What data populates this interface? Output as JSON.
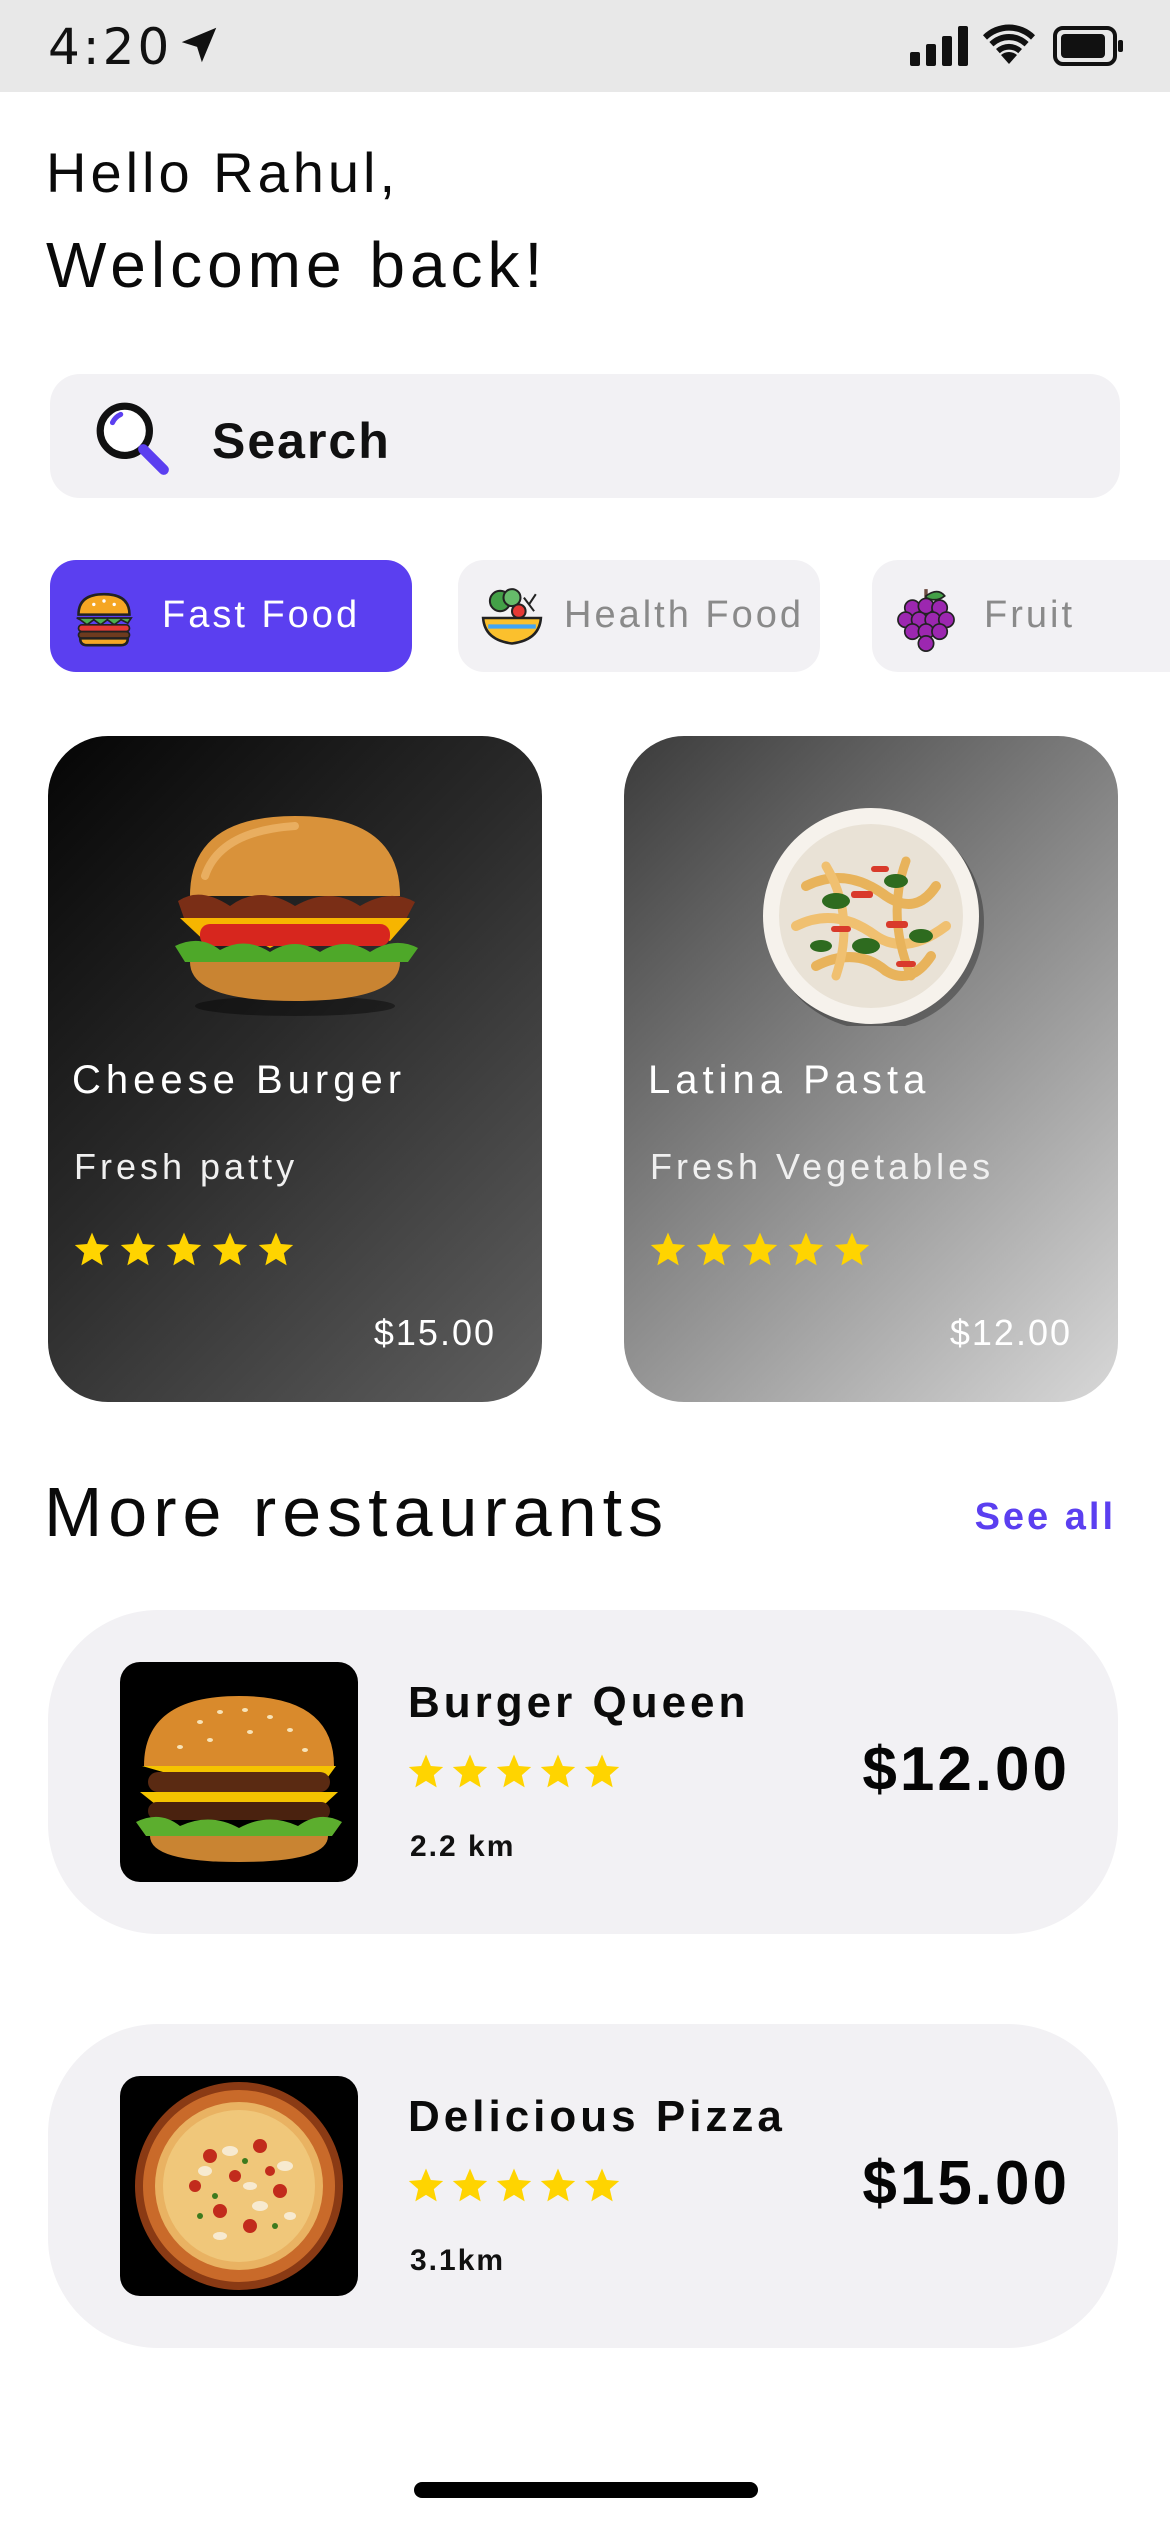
{
  "status_bar": {
    "time": "4:20"
  },
  "greeting": {
    "line1": "Hello Rahul,",
    "line2": "Welcome back!"
  },
  "search": {
    "placeholder": "Search"
  },
  "categories": [
    {
      "label": "Fast Food",
      "icon": "burger-icon",
      "selected": true
    },
    {
      "label": "Health Food",
      "icon": "salad-bowl-icon",
      "selected": false
    },
    {
      "label": "Fruit",
      "icon": "grapes-icon",
      "selected": false
    }
  ],
  "featured": [
    {
      "name": "Cheese Burger",
      "description": "Fresh patty",
      "rating": 5,
      "price": "$15.00"
    },
    {
      "name": "Latina Pasta",
      "description": "Fresh Vegetables",
      "rating": 5,
      "price": "$12.00"
    }
  ],
  "more_restaurants": {
    "title": "More restaurants",
    "see_all": "See all",
    "items": [
      {
        "name": "Burger Queen",
        "rating": 5,
        "distance": "2.2 km",
        "price": "$12.00"
      },
      {
        "name": "Delicious Pizza",
        "rating": 5,
        "distance": "3.1km",
        "price": "$15.00"
      }
    ]
  },
  "colors": {
    "accent": "#5b3ff0",
    "star": "#ffd400",
    "chip_bg": "#f2f1f4"
  }
}
